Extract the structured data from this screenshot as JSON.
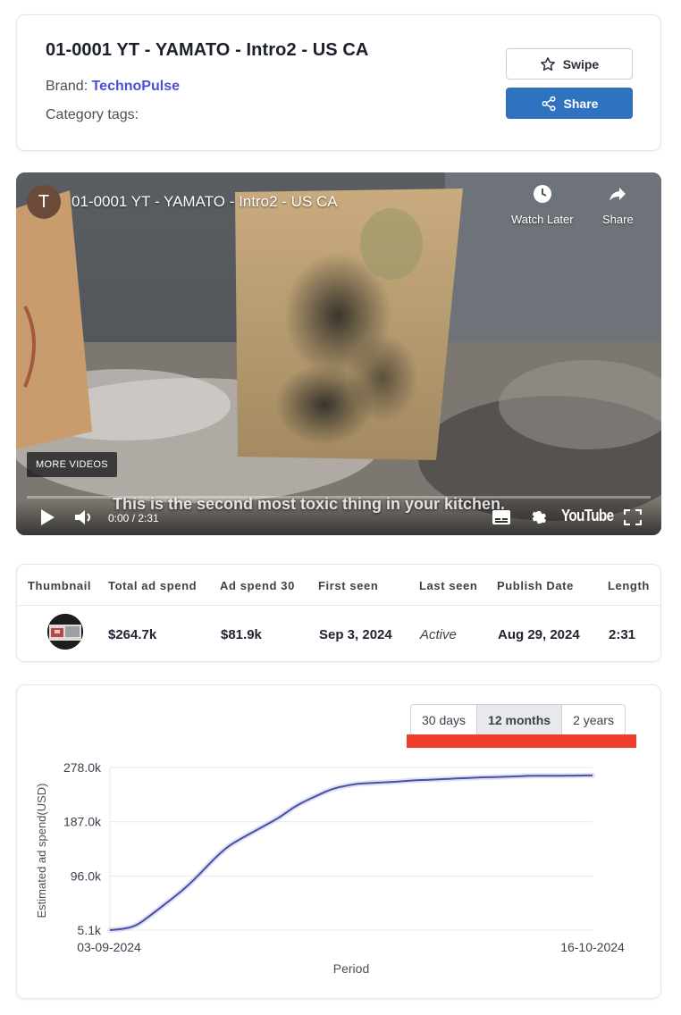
{
  "header": {
    "title": "01-0001 YT - YAMATO - Intro2 - US CA",
    "brand_label": "Brand:",
    "brand_name": "TechnoPulse",
    "category_label": "Category tags:",
    "swipe_label": "Swipe",
    "share_label": "Share"
  },
  "video": {
    "avatar_letter": "T",
    "title": "01-0001 YT - YAMATO - Intro2 - US CA",
    "watch_later_label": "Watch Later",
    "share_label": "Share",
    "more_videos_label": "MORE VIDEOS",
    "caption": "This is the second most toxic thing in your kitchen.",
    "time": "0:00 / 2:31",
    "logo_text": "YouTube"
  },
  "stats": {
    "headers": [
      "Thumbnail",
      "Total ad spend",
      "Ad spend 30",
      "First seen",
      "Last seen",
      "Publish Date",
      "Length"
    ],
    "total_ad_spend": "$264.7k",
    "ad_spend_30": "$81.9k",
    "first_seen": "Sep 3, 2024",
    "last_seen": "Active",
    "publish_date": "Aug 29, 2024",
    "length": "2:31"
  },
  "range": {
    "options": [
      "30 days",
      "12 months",
      "2 years"
    ],
    "active": "12 months"
  },
  "colors": {
    "accent": "#4b4fd8",
    "share_button": "#2f72c0",
    "line": "#4a4fa0",
    "highlight": "#ee3d2a"
  },
  "chart_data": {
    "type": "line",
    "ylabel": "Estimated ad spend(USD)",
    "xlabel": "Period",
    "ylim": [
      5.1,
      278.0
    ],
    "yticks": [
      "278.0k",
      "187.0k",
      "96.0k",
      "5.1k"
    ],
    "ytick_values": [
      278.0,
      187.0,
      96.0,
      5.1
    ],
    "x_start_label": "03-09-2024",
    "x_end_label": "16-10-2024",
    "grid": true,
    "series": [
      {
        "values": [
          5.1,
          7,
          12,
          28,
          45,
          62,
          80,
          102,
          125,
          145,
          158,
          170,
          182,
          194,
          210,
          222,
          232,
          242,
          247,
          251,
          252,
          253,
          254,
          256,
          257,
          258,
          259,
          260,
          261,
          262,
          262,
          263,
          264,
          264,
          264,
          264.3,
          264.5,
          264.7
        ]
      }
    ]
  }
}
